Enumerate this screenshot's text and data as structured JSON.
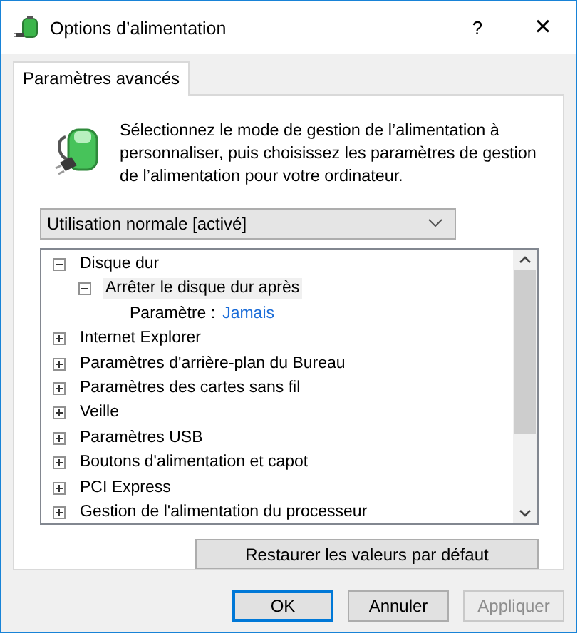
{
  "window": {
    "title": "Options d’alimentation",
    "help": "?",
    "close": "×"
  },
  "tabs": [
    {
      "label": "Paramètres avancés",
      "selected": true
    }
  ],
  "intro": "Sélectionnez le mode de gestion de l’alimentation à personnaliser, puis choisissez les paramètres de gestion de l’alimentation pour votre ordinateur.",
  "plan_dropdown": {
    "value": "Utilisation normale [activé]"
  },
  "tree": [
    {
      "kind": "node",
      "label": "Disque dur",
      "expanded": true,
      "selected": false,
      "children": [
        {
          "kind": "node",
          "label": "Arrêter le disque dur après",
          "expanded": true,
          "selected": true,
          "children": [
            {
              "kind": "setting",
              "label": "Paramètre :",
              "value": "Jamais"
            }
          ]
        }
      ]
    },
    {
      "kind": "node",
      "label": "Internet Explorer",
      "expanded": false,
      "selected": false
    },
    {
      "kind": "node",
      "label": "Paramètres d'arrière-plan du Bureau",
      "expanded": false,
      "selected": false
    },
    {
      "kind": "node",
      "label": "Paramètres des cartes sans fil",
      "expanded": false,
      "selected": false
    },
    {
      "kind": "node",
      "label": "Veille",
      "expanded": false,
      "selected": false
    },
    {
      "kind": "node",
      "label": "Paramètres USB",
      "expanded": false,
      "selected": false
    },
    {
      "kind": "node",
      "label": "Boutons d'alimentation et capot",
      "expanded": false,
      "selected": false
    },
    {
      "kind": "node",
      "label": "PCI Express",
      "expanded": false,
      "selected": false
    },
    {
      "kind": "node",
      "label": "Gestion de l'alimentation du processeur",
      "expanded": false,
      "selected": false
    }
  ],
  "restore_button": "Restaurer les valeurs par défaut",
  "buttons": [
    {
      "label": "OK",
      "default": true,
      "disabled": false
    },
    {
      "label": "Annuler",
      "default": false,
      "disabled": false
    },
    {
      "label": "Appliquer",
      "default": false,
      "disabled": true
    }
  ]
}
